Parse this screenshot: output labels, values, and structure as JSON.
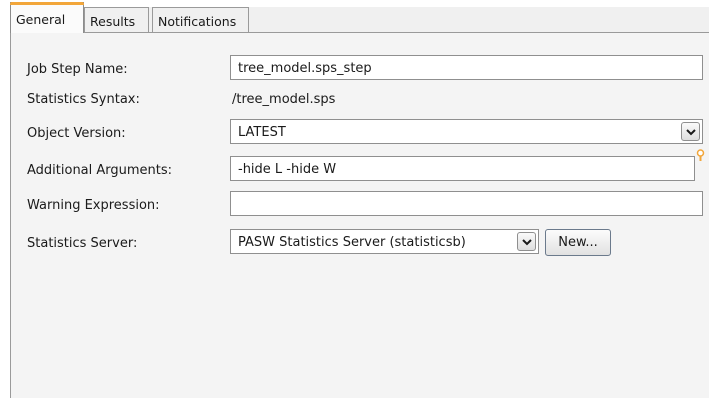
{
  "tabs": [
    {
      "label": "General",
      "active": true
    },
    {
      "label": "Results",
      "active": false
    },
    {
      "label": "Notifications",
      "active": false
    }
  ],
  "form": {
    "job_step_name": {
      "label": "Job Step Name:",
      "value": "tree_model.sps_step"
    },
    "statistics_syntax": {
      "label": "Statistics Syntax:",
      "value": "/tree_model.sps"
    },
    "object_version": {
      "label": "Object Version:",
      "value": "LATEST"
    },
    "additional_arguments": {
      "label": "Additional Arguments:",
      "value": "-hide L -hide W"
    },
    "warning_expression": {
      "label": "Warning Expression:",
      "value": ""
    },
    "statistics_server": {
      "label": "Statistics Server:",
      "value": "PASW Statistics Server (statisticsb)",
      "new_button": "New..."
    }
  },
  "colors": {
    "active_tab_accent": "#f2a63a",
    "warning_icon": "#f2a63a"
  },
  "icons": {
    "dropdown": "chevron-down-icon",
    "warning": "warning-icon"
  }
}
